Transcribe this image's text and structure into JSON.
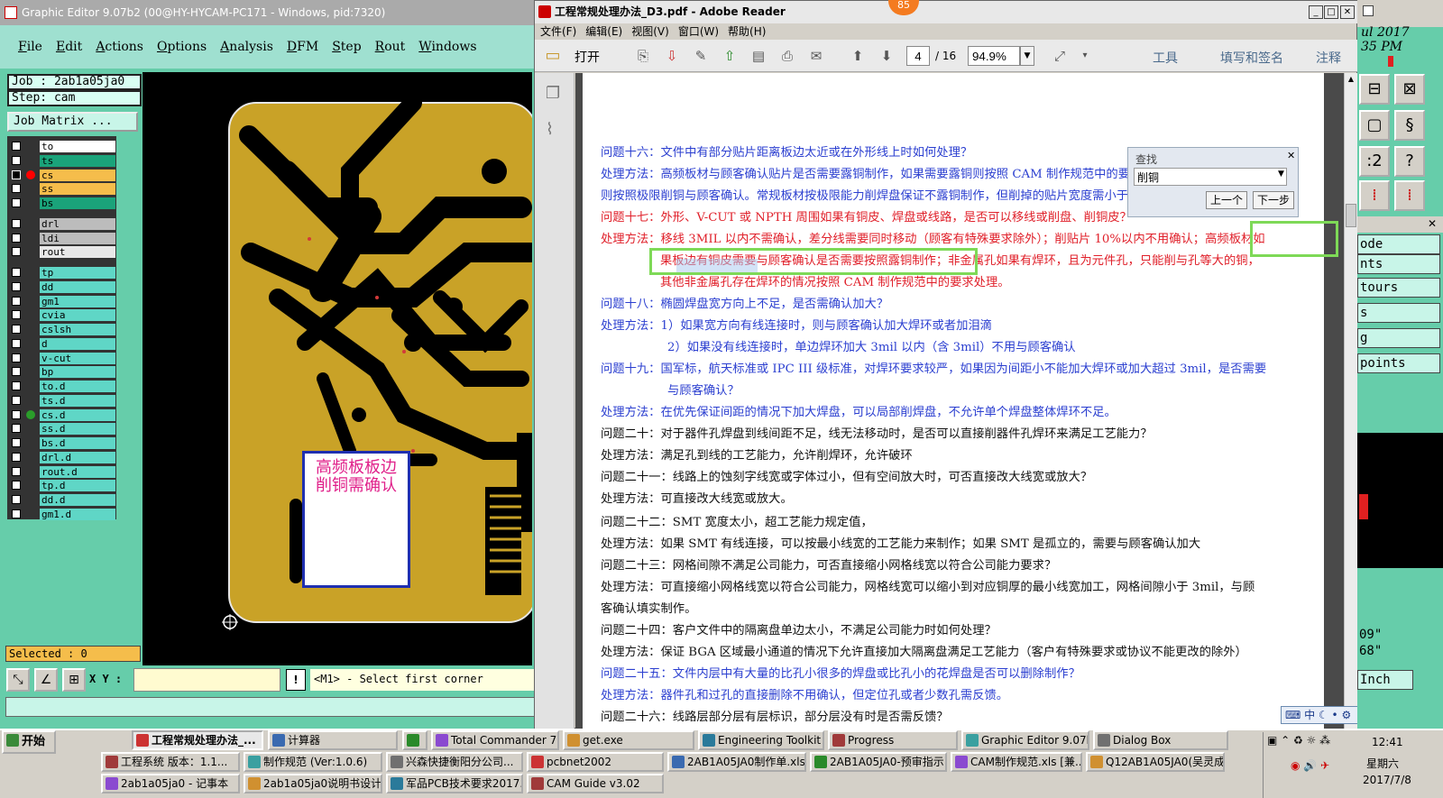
{
  "graphic_editor": {
    "title": "Graphic Editor 9.07b2 (00@HY-HYCAM-PC171 - Windows, pid:7320)",
    "menu": [
      "File",
      "Edit",
      "Actions",
      "Options",
      "Analysis",
      "DFM",
      "Step",
      "Rout",
      "Windows"
    ],
    "job": "Job : 2ab1a05ja0",
    "step": "Step: cam",
    "job_matrix_button": "Job Matrix ...",
    "layers": [
      {
        "name": "to",
        "color": "#ffffff",
        "dot": ""
      },
      {
        "name": "ts",
        "color": "#1aa37a",
        "dot": ""
      },
      {
        "name": "cs",
        "color": "#f5bd4b",
        "dot": "#ff0000",
        "selected": true
      },
      {
        "name": "ss",
        "color": "#f5bd4b",
        "dot": ""
      },
      {
        "name": "bs",
        "color": "#1aa37a",
        "dot": ""
      },
      {
        "name": "drl",
        "color": "#bcbcbc",
        "dot": ""
      },
      {
        "name": "ldi",
        "color": "#bcbcbc",
        "dot": ""
      },
      {
        "name": "rout",
        "color": "#e8e8e8",
        "dot": ""
      },
      {
        "name": "tp",
        "color": "#5fd6c6",
        "dot": ""
      },
      {
        "name": "dd",
        "color": "#5fd6c6",
        "dot": ""
      },
      {
        "name": "gm1",
        "color": "#5fd6c6",
        "dot": ""
      },
      {
        "name": "cvia",
        "color": "#5fd6c6",
        "dot": ""
      },
      {
        "name": "cslsh",
        "color": "#5fd6c6",
        "dot": ""
      },
      {
        "name": "d",
        "color": "#5fd6c6",
        "dot": ""
      },
      {
        "name": "v-cut",
        "color": "#5fd6c6",
        "dot": ""
      },
      {
        "name": "bp",
        "color": "#5fd6c6",
        "dot": ""
      },
      {
        "name": "to.d",
        "color": "#5fd6c6",
        "dot": ""
      },
      {
        "name": "ts.d",
        "color": "#5fd6c6",
        "dot": ""
      },
      {
        "name": "cs.d",
        "color": "#5fd6c6",
        "dot": "#2a9d2a"
      },
      {
        "name": "ss.d",
        "color": "#5fd6c6",
        "dot": ""
      },
      {
        "name": "bs.d",
        "color": "#5fd6c6",
        "dot": ""
      },
      {
        "name": "drl.d",
        "color": "#5fd6c6",
        "dot": ""
      },
      {
        "name": "rout.d",
        "color": "#5fd6c6",
        "dot": ""
      },
      {
        "name": "tp.d",
        "color": "#5fd6c6",
        "dot": ""
      },
      {
        "name": "dd.d",
        "color": "#5fd6c6",
        "dot": ""
      },
      {
        "name": "gm1.d",
        "color": "#5fd6c6",
        "dot": ""
      }
    ],
    "selected": "Selected : 0",
    "xy_label": "X Y :",
    "prompt": "<M1> - Select first corner",
    "warn_glyph": "!",
    "annotation": "高频板板边削铜需确认",
    "colors": {
      "copper": "#c9a227",
      "board_bg": "#000000",
      "annotation_text": "#e0208a",
      "annotation_border": "#1f2fb0"
    }
  },
  "reader": {
    "title": "工程常规处理办法_D3.pdf - Adobe Reader",
    "badge": "85",
    "menu": [
      "文件(F)",
      "编辑(E)",
      "视图(V)",
      "窗口(W)",
      "帮助(H)"
    ],
    "open_label": "打开",
    "page_current": "4",
    "page_total": "/ 16",
    "zoom": "94.9%",
    "links": [
      "工具",
      "填写和签名",
      "注释"
    ],
    "find": {
      "title": "查找",
      "value": "削铜",
      "prev": "上一个",
      "next": "下一步"
    },
    "ime": "中"
  },
  "document_lines": [
    {
      "c": "blue",
      "indent": 0,
      "t": "问题十六：文件中有部分贴片距离板边太近或在外形线上时如何处理？"
    },
    {
      "c": "blue",
      "indent": 0,
      "t": "处理方法：高频板材与顾客确认贴片是否需要露铜制作，如果需要露铜则按照 CAM 制作规范中的要求处理，如果不需要露铜，"
    },
    {
      "c": "blue",
      "indent": 0,
      "t": "则按照极限削铜与顾客确认。常规板材按极限能力削焊盘保证不露铜制作，但削掉的贴片宽度需小于原贴片宽度的 10%之内。"
    },
    {
      "c": "red",
      "indent": 0,
      "t": "问题十七：外形、V-CUT 或 NPTH 周围如果有铜皮、焊盘或线路，是否可以移线或削盘、削铜皮？"
    },
    {
      "c": "red",
      "indent": 0,
      "t": "处理方法：移线 3MIL 以内不需确认，差分线需要同时移动（顾客有特殊要求除外）；削贴片 10%以内不用确认；高频板材如"
    },
    {
      "c": "red",
      "indent": 66,
      "t": "果板边有铜皮需要与顾客确认是否需要按照露铜制作；非金属孔如果有焊环，且为元件孔，只能削与孔等大的铜，"
    },
    {
      "c": "red",
      "indent": 66,
      "t": "其他非金属孔存在焊环的情况按照 CAM 制作规范中的要求处理。"
    },
    {
      "c": "blue",
      "indent": 0,
      "t": "问题十八：椭圆焊盘宽方向上不足，是否需确认加大？"
    },
    {
      "c": "blue",
      "indent": 0,
      "t": "处理方法：1）如果宽方向有线连接时，则与顾客确认加大焊环或者加泪滴"
    },
    {
      "c": "blue",
      "indent": 74,
      "t": "2）如果没有线连接时，单边焊环加大 3mil 以内（含 3mil）不用与顾客确认"
    },
    {
      "c": "blue",
      "indent": 0,
      "t": "问题十九：国军标，航天标准或 IPC III 级标准，对焊环要求较严，如果因为间距小不能加大焊环或加大超过 3mil，是否需要"
    },
    {
      "c": "blue",
      "indent": 74,
      "t": "与顾客确认？"
    },
    {
      "c": "blue",
      "indent": 0,
      "t": "处理方法：在优先保证间距的情况下加大焊盘，可以局部削焊盘，不允许单个焊盘整体焊环不足。"
    },
    {
      "c": "blk",
      "indent": 0,
      "t": "问题二十：对于器件孔焊盘到线间距不足，线无法移动时，是否可以直接削器件孔焊环来满足工艺能力？"
    },
    {
      "c": "blk",
      "indent": 0,
      "t": "处理方法：满足孔到线的工艺能力，允许削焊环，允许破环"
    },
    {
      "c": "blk",
      "indent": 0,
      "t": "问题二十一：线路上的蚀刻字线宽或字体过小，但有空间放大时，可否直接改大线宽或放大？"
    },
    {
      "c": "blk",
      "indent": 0,
      "t": "处理方法：可直接改大线宽或放大。"
    },
    {
      "c": "blk",
      "indent": 0,
      "t": "问题二十二：SMT 宽度太小，超工艺能力规定值，"
    },
    {
      "c": "blk",
      "indent": 0,
      "t": "处理方法：如果 SMT 有线连接，可以按最小线宽的工艺能力来制作；如果 SMT 是孤立的，需要与顾客确认加大"
    },
    {
      "c": "blk",
      "indent": 0,
      "t": "问题二十三：网格间隙不满足公司能力，可否直接缩小网格线宽以符合公司能力要求？"
    },
    {
      "c": "blk",
      "indent": 0,
      "t": "处理方法：可直接缩小网格线宽以符合公司能力，网格线宽可以缩小到对应铜厚的最小线宽加工，网格间隙小于 3mil，与顾"
    },
    {
      "c": "blk",
      "indent": 0,
      "t": "客确认填实制作。"
    },
    {
      "c": "blk",
      "indent": 0,
      "t": "问题二十四：客户文件中的隔离盘单边太小，不满足公司能力时如何处理？"
    },
    {
      "c": "blk",
      "indent": 0,
      "t": "处理方法：保证 BGA 区域最小通道的情况下允许直接加大隔离盘满足工艺能力（客户有特殊要求或协议不能更改的除外）"
    },
    {
      "c": "blue",
      "indent": 0,
      "t": "问题二十五：文件内层中有大量的比孔小很多的焊盘或比孔小的花焊盘是否可以删除制作？"
    },
    {
      "c": "blue",
      "indent": 0,
      "t": "处理方法：器件孔和过孔的直接删除不用确认，但定位孔或者少数孔需反馈。"
    },
    {
      "c": "blk",
      "indent": 0,
      "t": "问题二十六：线路层部分层有层标识，部分层没有时是否需反馈？"
    }
  ],
  "right_panel": {
    "date_partial": "ul 2017",
    "time_partial": "35 PM",
    "items": [
      "ode",
      "nts",
      "tours",
      "s",
      "g",
      "points"
    ],
    "coord1": "09\"",
    "coord2": "68\"",
    "unit": "Inch"
  },
  "taskbar": {
    "start": "开始",
    "row1": [
      "工程常规处理办法_...",
      "计算器",
      "",
      "Total Commander 7.0 ...",
      "get.exe",
      "Engineering Toolkit 9.0...",
      "Progress",
      "Graphic Editor 9.07b2 ...",
      "Dialog Box"
    ],
    "row2": [
      "工程系统  版本：1.1...",
      "制作规范 (Ver:1.0.6)",
      "兴森快捷衡阳分公司...",
      "pcbnet2002",
      "2AB1A05JA0制作单.xls ...",
      "2AB1A05JA0-预审指示...",
      "CAM制作规范.xls [兼...",
      "Q12AB1A05JA0(吴灵成..."
    ],
    "row3": [
      "2ab1a05ja0 - 记事本",
      "2ab1a05ja0说明书设计以...",
      "军品PCB技术要求2017...",
      "CAM Guide v3.02"
    ],
    "clock": "12:41",
    "weekday": "星期六",
    "date": "2017/7/8"
  }
}
